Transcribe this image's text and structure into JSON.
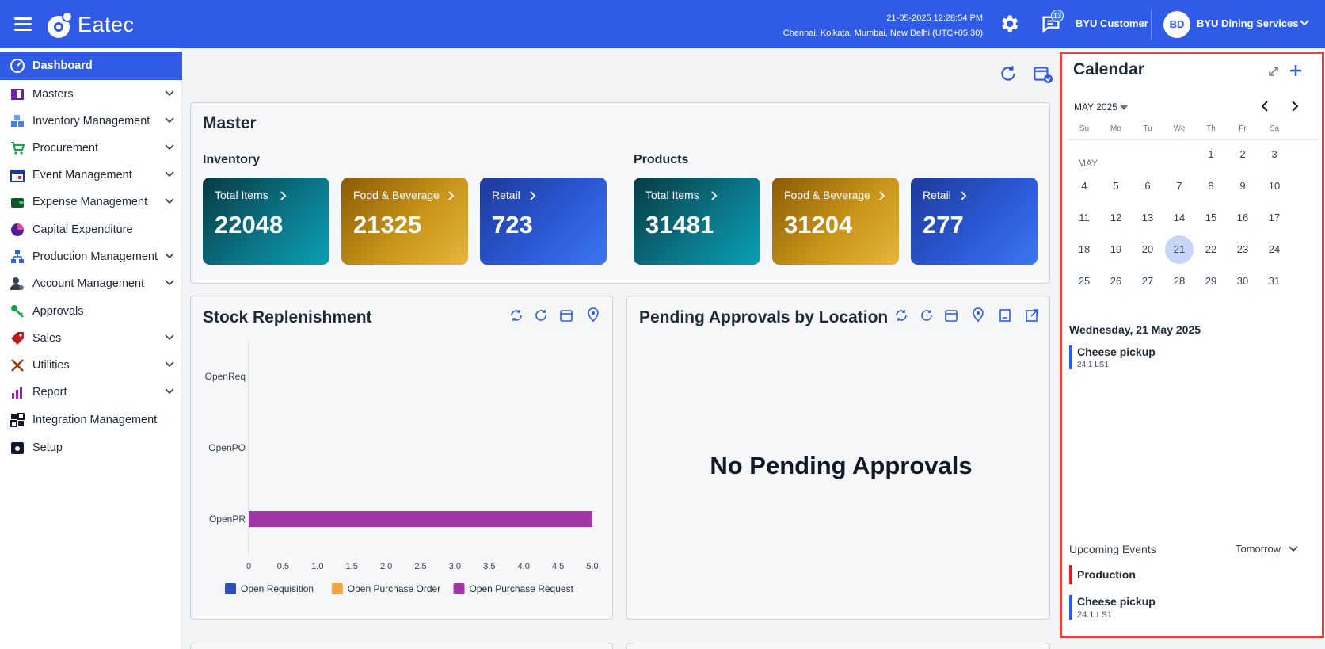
{
  "header": {
    "app_name": "Eatec",
    "datetime": "21-05-2025 12:28:54 PM",
    "timezone": "Chennai, Kolkata, Mumbai, New Delhi (UTC+05:30)",
    "notification_count": "13",
    "customer": "BYU Customer",
    "avatar_initials": "BD",
    "organization": "BYU Dining Services"
  },
  "sidebar": {
    "items": [
      {
        "label": "Dashboard",
        "icon": "gauge-icon"
      },
      {
        "label": "Masters",
        "icon": "book-icon"
      },
      {
        "label": "Inventory Management",
        "icon": "boxes-icon"
      },
      {
        "label": "Procurement",
        "icon": "cart-icon"
      },
      {
        "label": "Event Management",
        "icon": "calendar-icon"
      },
      {
        "label": "Expense Management",
        "icon": "wallet-icon"
      },
      {
        "label": "Capital Expenditure",
        "icon": "chart-pie-icon"
      },
      {
        "label": "Production Management",
        "icon": "hierarchy-icon"
      },
      {
        "label": "Account Management",
        "icon": "user-gear-icon"
      },
      {
        "label": "Approvals",
        "icon": "key-icon"
      },
      {
        "label": "Sales",
        "icon": "tag-icon"
      },
      {
        "label": "Utilities",
        "icon": "tools-icon"
      },
      {
        "label": "Report",
        "icon": "bar-chart-icon"
      },
      {
        "label": "Integration Management",
        "icon": "integration-icon"
      },
      {
        "label": "Setup",
        "icon": "settings-box-icon"
      }
    ]
  },
  "master": {
    "title": "Master",
    "inventory": {
      "label": "Inventory",
      "tiles": [
        {
          "label": "Total Items",
          "value": "22048"
        },
        {
          "label": "Food & Beverage",
          "value": "21325"
        },
        {
          "label": "Retail",
          "value": "723"
        }
      ]
    },
    "products": {
      "label": "Products",
      "tiles": [
        {
          "label": "Total Items",
          "value": "31481"
        },
        {
          "label": "Food & Beverage",
          "value": "31204"
        },
        {
          "label": "Retail",
          "value": "277"
        }
      ]
    }
  },
  "stock": {
    "title": "Stock Replenishment"
  },
  "approvals": {
    "title": "Pending Approvals by Location",
    "empty_text": "No Pending Approvals"
  },
  "chart_data": {
    "type": "bar",
    "orientation": "horizontal",
    "categories": [
      "OpenReq",
      "OpenPO",
      "OpenPR"
    ],
    "series": [
      {
        "name": "Open Requisition",
        "values": [
          0,
          0,
          0
        ],
        "color": "#2c4fb8"
      },
      {
        "name": "Open Purchase Order",
        "values": [
          0,
          0,
          0
        ],
        "color": "#f4a43a"
      },
      {
        "name": "Open Purchase Request",
        "values": [
          0,
          0,
          5
        ],
        "color": "#a236a6"
      }
    ],
    "xlim": [
      0,
      5
    ],
    "xticks": [
      "0",
      "0.5",
      "1.0",
      "1.5",
      "2.0",
      "2.5",
      "3.0",
      "3.5",
      "4.0",
      "4.5",
      "5.0"
    ],
    "legend_position": "bottom"
  },
  "calendar": {
    "title": "Calendar",
    "month_label": "MAY 2025",
    "weekdays": [
      "Su",
      "Mo",
      "Tu",
      "We",
      "Th",
      "Fr",
      "Sa"
    ],
    "month_short": "MAY",
    "weeks": [
      [
        "",
        "",
        "",
        "",
        "1",
        "2",
        "3"
      ],
      [
        "4",
        "5",
        "6",
        "7",
        "8",
        "9",
        "10"
      ],
      [
        "11",
        "12",
        "13",
        "14",
        "15",
        "16",
        "17"
      ],
      [
        "18",
        "19",
        "20",
        "21",
        "22",
        "23",
        "24"
      ],
      [
        "25",
        "26",
        "27",
        "28",
        "29",
        "30",
        "31"
      ]
    ],
    "selected_day": "21",
    "selected_date_label": "Wednesday, 21 May 2025",
    "events": [
      {
        "title": "Cheese pickup",
        "sub": "24.1 LS1"
      }
    ],
    "upcoming_title": "Upcoming Events",
    "upcoming_filter": "Tomorrow",
    "upcoming": [
      {
        "title": "Production",
        "sub": ""
      },
      {
        "title": "Cheese pickup",
        "sub": "24.1 LS1"
      }
    ]
  }
}
